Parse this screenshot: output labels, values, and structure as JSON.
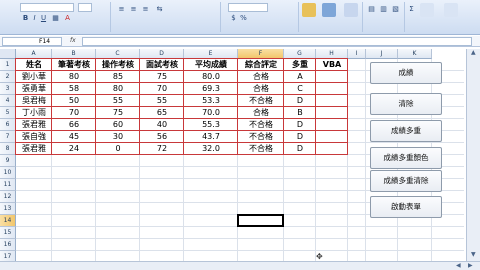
{
  "name_box": "F14",
  "fx_label": "fx",
  "columns": [
    "A",
    "B",
    "C",
    "D",
    "E",
    "F",
    "G",
    "H",
    "I",
    "J",
    "K"
  ],
  "selected_column": "F",
  "rows": [
    "1",
    "2",
    "3",
    "4",
    "5",
    "6",
    "7",
    "8",
    "9",
    "10",
    "11",
    "12",
    "13",
    "14",
    "15",
    "16",
    "17"
  ],
  "selected_row": "14",
  "table": {
    "headers": [
      "姓名",
      "筆著考核",
      "操作考核",
      "面試考核",
      "平均成績",
      "綜合評定",
      "多重",
      "VBA"
    ],
    "records": [
      [
        "劉小華",
        "80",
        "85",
        "75",
        "80.0",
        "合格",
        "A",
        ""
      ],
      [
        "張勇華",
        "58",
        "80",
        "70",
        "69.3",
        "合格",
        "C",
        ""
      ],
      [
        "吳君梅",
        "50",
        "55",
        "55",
        "53.3",
        "不合格",
        "D",
        ""
      ],
      [
        "丁小雨",
        "70",
        "75",
        "65",
        "70.0",
        "合格",
        "B",
        ""
      ],
      [
        "張君雅",
        "66",
        "60",
        "40",
        "55.3",
        "不合格",
        "D",
        ""
      ],
      [
        "張自強",
        "45",
        "30",
        "56",
        "43.7",
        "不合格",
        "D",
        ""
      ],
      [
        "張君雅",
        "24",
        "0",
        "72",
        "32.0",
        "不合格",
        "D",
        ""
      ]
    ]
  },
  "buttons": [
    "成績",
    "清除",
    "成績多重",
    "成績多重顏色",
    "成績多重清除",
    "啟動表單"
  ],
  "colors": {
    "table_border": "#c8383a",
    "header_highlight": "#f2c66b"
  },
  "icons": [
    "bold-icon",
    "italic-icon",
    "underline-icon",
    "font-color-icon",
    "align-center-icon",
    "sort-icon",
    "find-icon"
  ]
}
